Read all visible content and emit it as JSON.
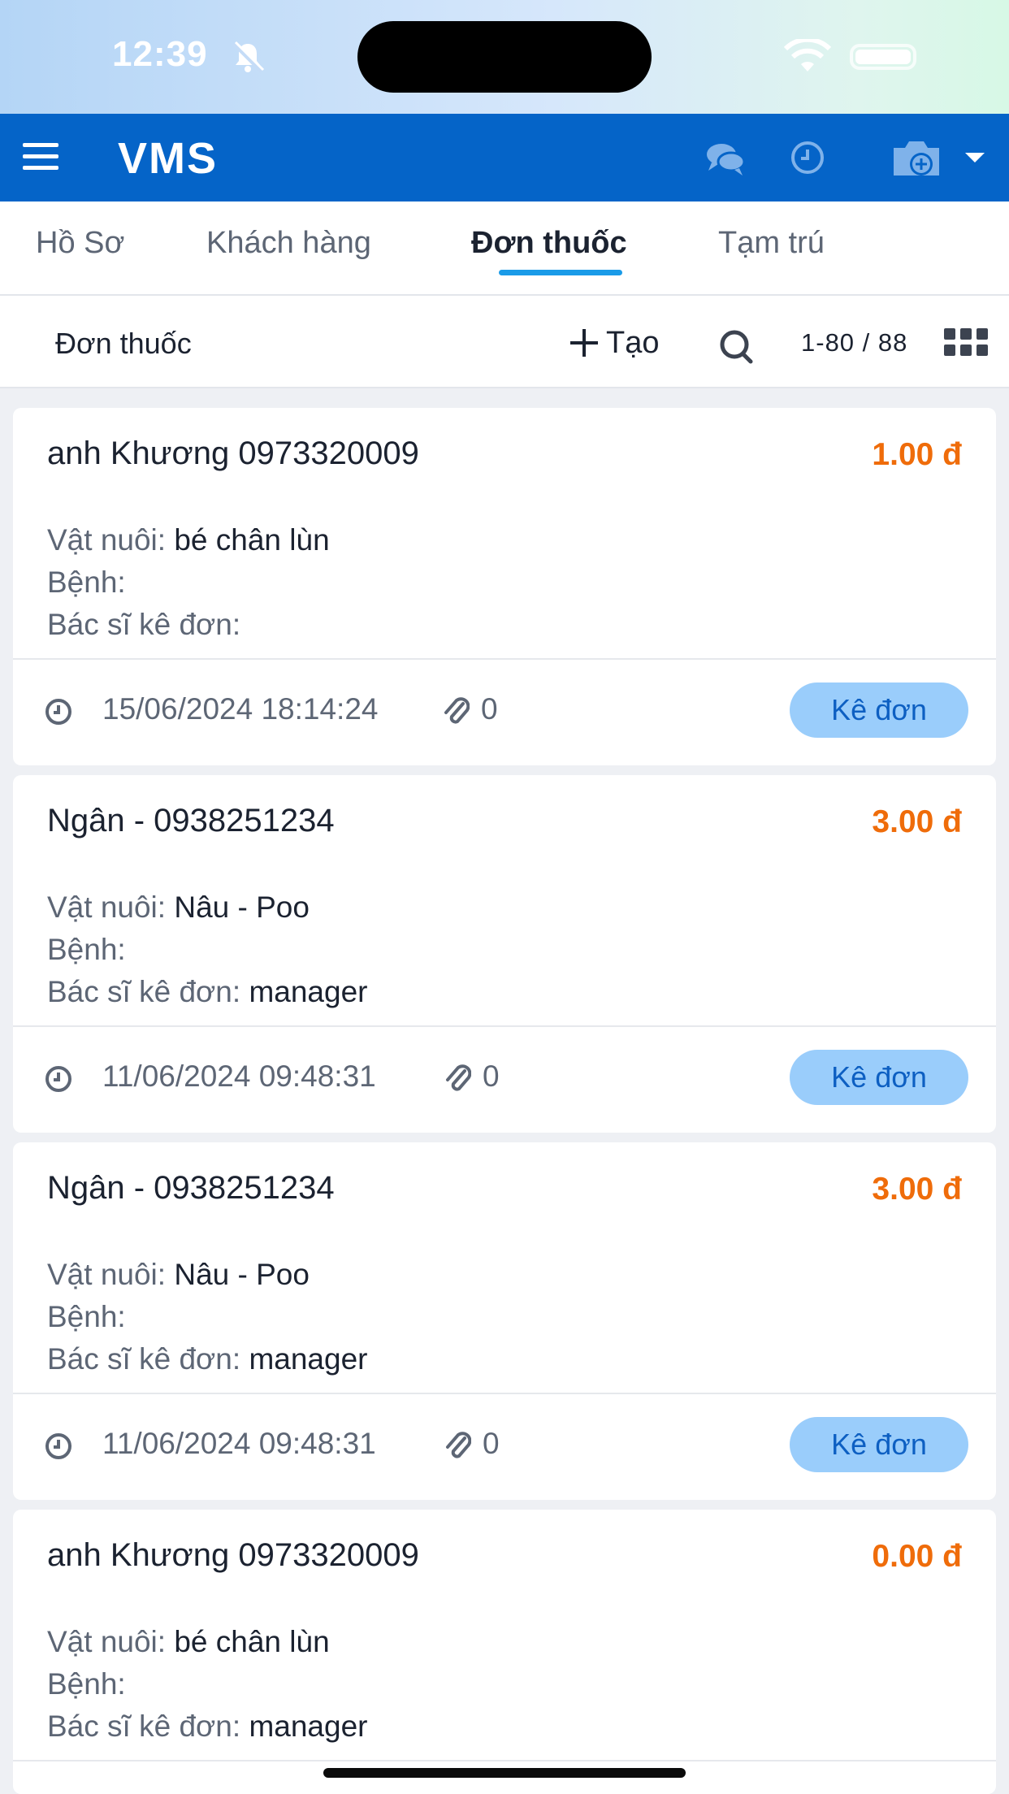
{
  "status_bar": {
    "time": "12:39"
  },
  "header": {
    "title": "VMS"
  },
  "tabs": [
    {
      "label": "Hồ Sơ"
    },
    {
      "label": "Khách hàng"
    },
    {
      "label": "Đơn thuốc",
      "active": true
    },
    {
      "label": "Tạm trú"
    }
  ],
  "toolbar": {
    "title": "Đơn thuốc",
    "create_label": "Tạo",
    "pager": "1-80 / 88"
  },
  "labels": {
    "pet": "Vật nuôi:",
    "disease": "Bệnh:",
    "doctor": "Bác sĩ kê đơn:"
  },
  "prescriptions": [
    {
      "customer": "anh Khương 0973320009",
      "price": "1.00 đ",
      "pet": "bé chân lùn",
      "disease": "",
      "doctor": "",
      "datetime": "15/06/2024 18:14:24",
      "attachments": "0",
      "action": "Kê đơn"
    },
    {
      "customer": "Ngân - 0938251234",
      "price": "3.00 đ",
      "pet": "Nâu - Poo",
      "disease": "",
      "doctor": "manager",
      "datetime": "11/06/2024 09:48:31",
      "attachments": "0",
      "action": "Kê đơn"
    },
    {
      "customer": "Ngân - 0938251234",
      "price": "3.00 đ",
      "pet": "Nâu - Poo",
      "disease": "",
      "doctor": "manager",
      "datetime": "11/06/2024 09:48:31",
      "attachments": "0",
      "action": "Kê đơn"
    },
    {
      "customer": "anh Khương 0973320009",
      "price": "0.00 đ",
      "pet": "bé chân lùn",
      "disease": "",
      "doctor": "manager"
    }
  ],
  "colors": {
    "header_bg": "#0564c8",
    "price": "#ef6c0a",
    "tab_indicator": "#1a9be8",
    "action_button_bg": "#9acdfb",
    "action_button_text": "#0d5fc2"
  }
}
